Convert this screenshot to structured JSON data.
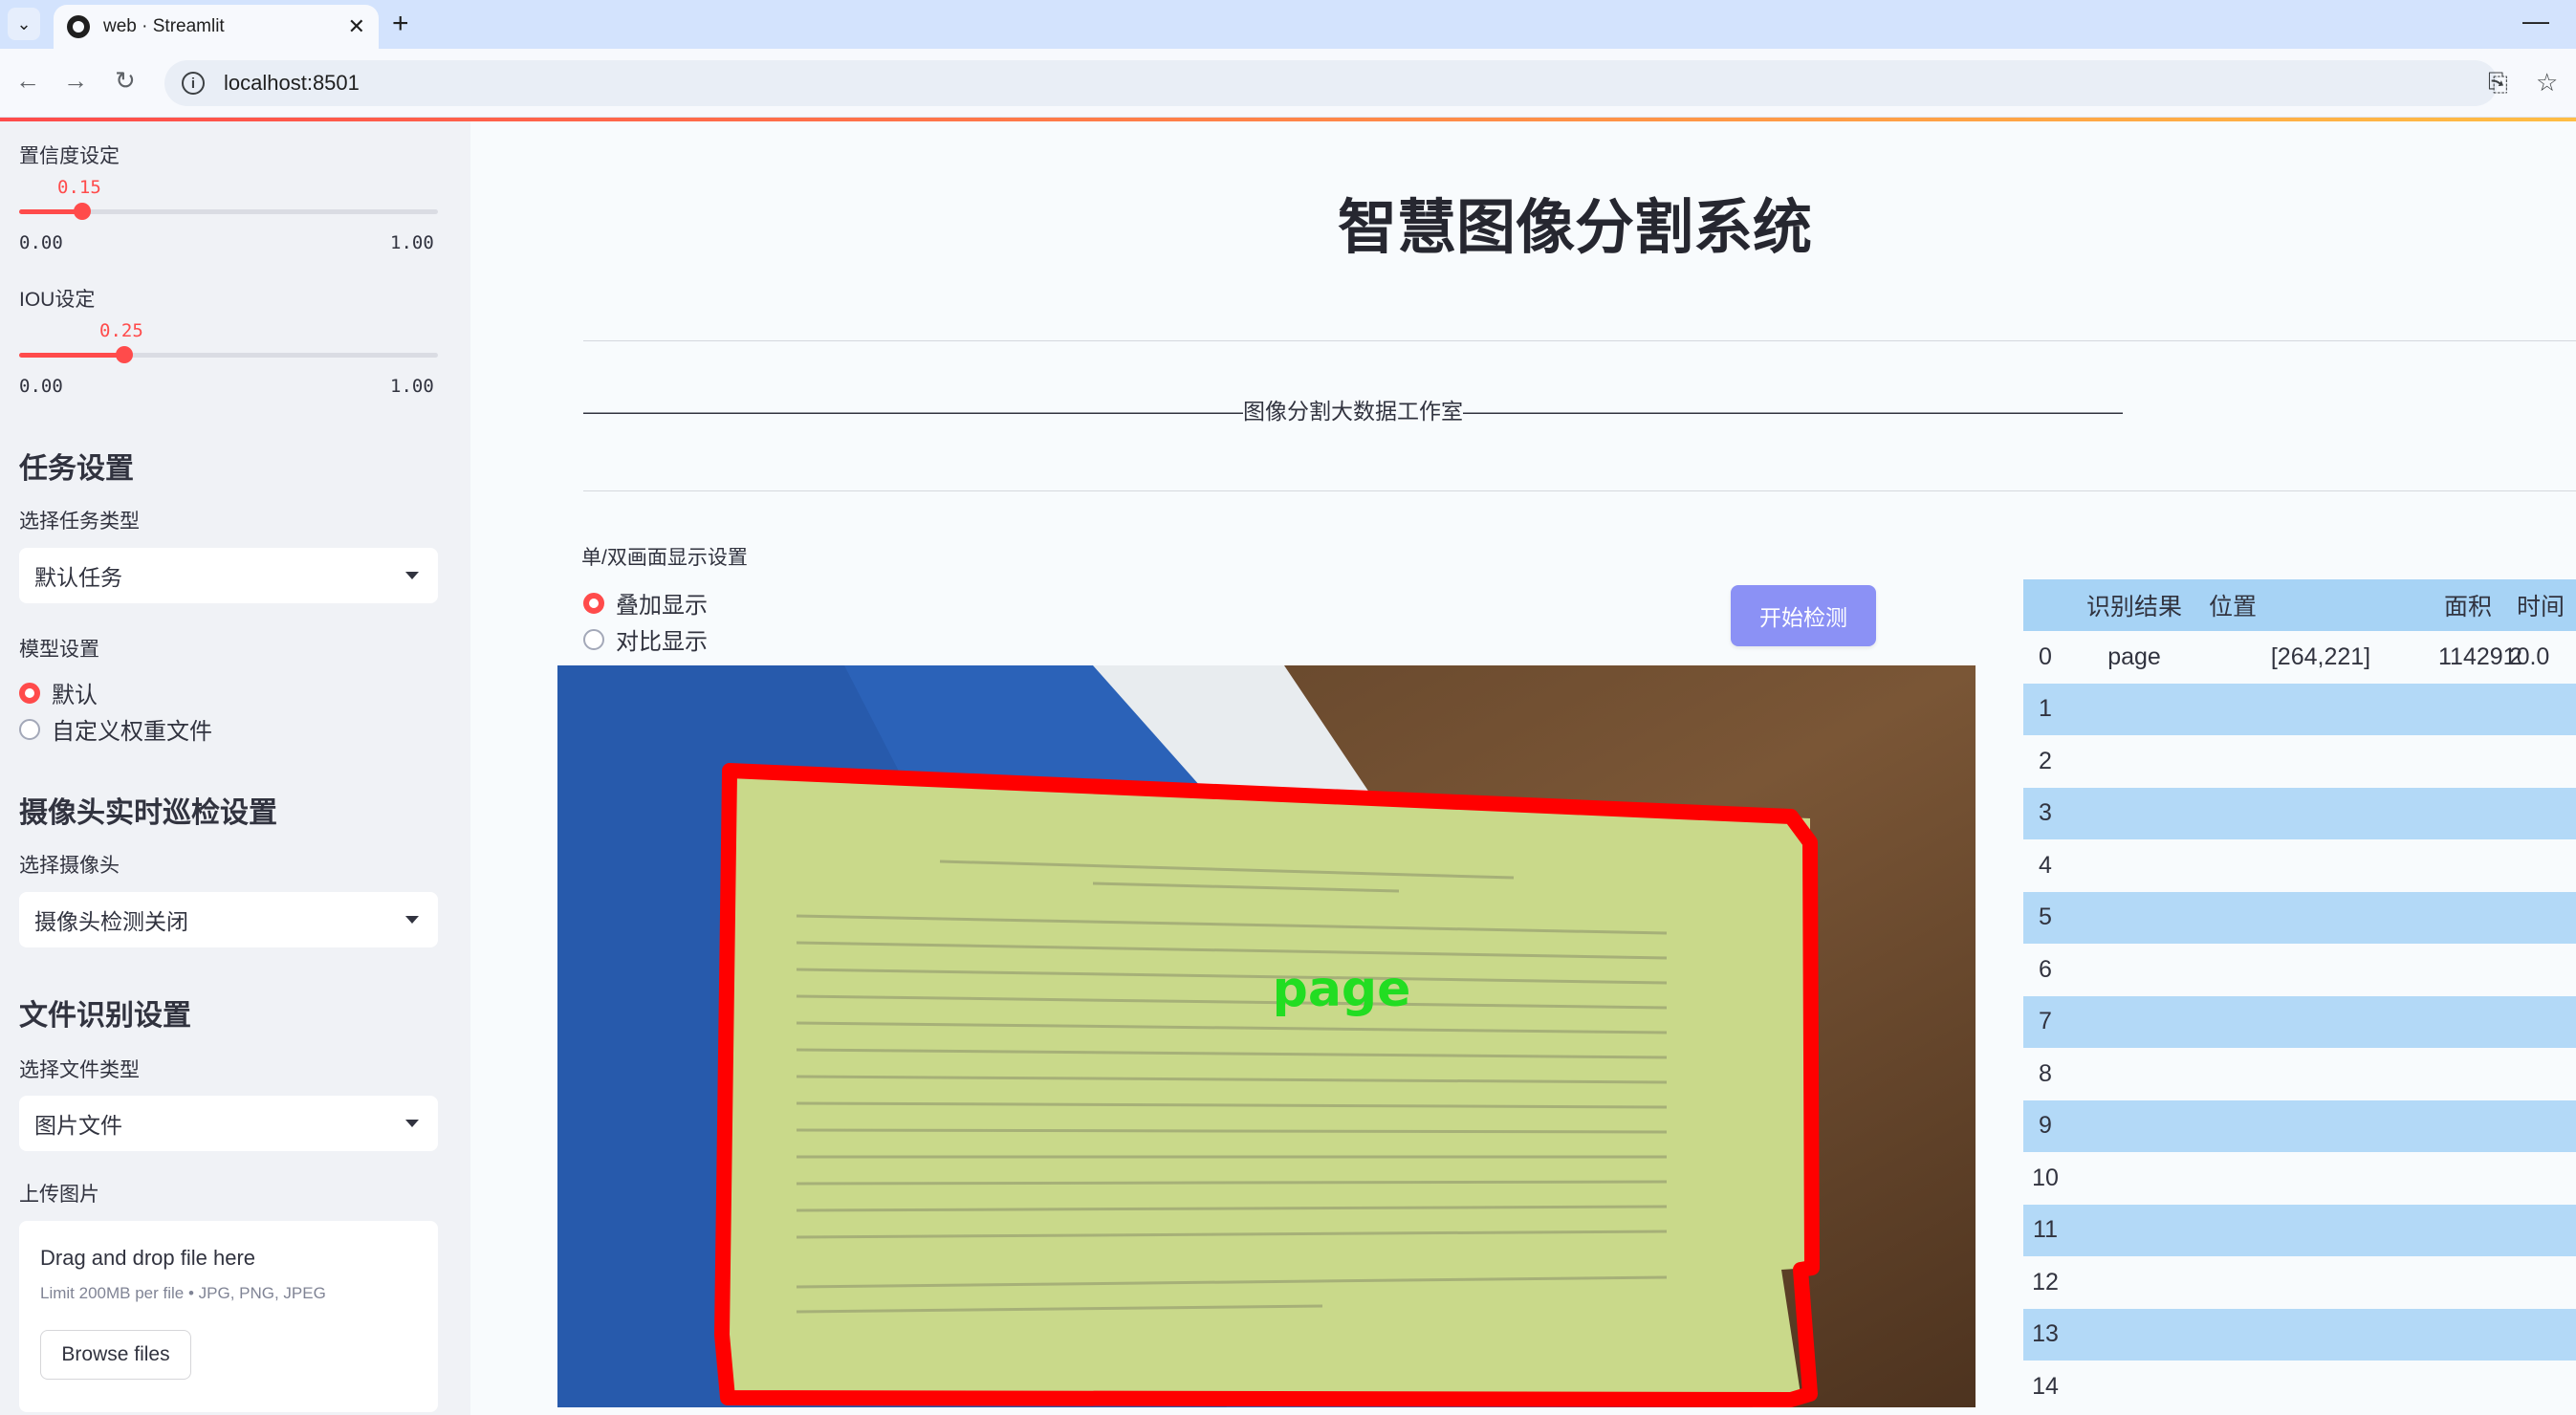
{
  "browser": {
    "tab_title": "web · Streamlit",
    "url": "localhost:8501"
  },
  "sidebar": {
    "confidence": {
      "label": "置信度设定",
      "value_text": "0.15",
      "value": 0.15,
      "min_text": "0.00",
      "max_text": "1.00"
    },
    "iou": {
      "label": "IOU设定",
      "value_text": "0.25",
      "value": 0.25,
      "min_text": "0.00",
      "max_text": "1.00"
    },
    "task_section": {
      "header": "任务设置",
      "select_label": "选择任务类型",
      "selected": "默认任务"
    },
    "model_section": {
      "label": "模型设置",
      "options": [
        "默认",
        "自定义权重文件"
      ],
      "selected_index": 0
    },
    "camera_section": {
      "header": "摄像头实时巡检设置",
      "select_label": "选择摄像头",
      "selected": "摄像头检测关闭"
    },
    "file_section": {
      "header": "文件识别设置",
      "select_label": "选择文件类型",
      "selected": "图片文件"
    },
    "upload": {
      "label": "上传图片",
      "drop_text": "Drag and drop file here",
      "limit_text": "Limit 200MB per file • JPG, PNG, JPEG",
      "button": "Browse files"
    }
  },
  "main": {
    "title": "智慧图像分割系统",
    "studio_line": "——————————————————————————————图像分割大数据工作室——————————————————————————————",
    "display_mode": {
      "label": "单/双画面显示设置",
      "options": [
        "叠加显示",
        "对比显示"
      ],
      "selected_index": 0
    },
    "start_button": "开始检测",
    "detection_label": "page",
    "table": {
      "columns": [
        "识别结果",
        "位置",
        "面积",
        "时间"
      ],
      "rows": [
        {
          "index": "0",
          "result": "page",
          "position": "[264,221]",
          "area": "1142910.0",
          "time": "2"
        },
        {
          "index": "1",
          "result": "",
          "position": "",
          "area": "",
          "time": ""
        },
        {
          "index": "2",
          "result": "",
          "position": "",
          "area": "",
          "time": ""
        },
        {
          "index": "3",
          "result": "",
          "position": "",
          "area": "",
          "time": ""
        },
        {
          "index": "4",
          "result": "",
          "position": "",
          "area": "",
          "time": ""
        },
        {
          "index": "5",
          "result": "",
          "position": "",
          "area": "",
          "time": ""
        },
        {
          "index": "6",
          "result": "",
          "position": "",
          "area": "",
          "time": ""
        },
        {
          "index": "7",
          "result": "",
          "position": "",
          "area": "",
          "time": ""
        },
        {
          "index": "8",
          "result": "",
          "position": "",
          "area": "",
          "time": ""
        },
        {
          "index": "9",
          "result": "",
          "position": "",
          "area": "",
          "time": ""
        },
        {
          "index": "10",
          "result": "",
          "position": "",
          "area": "",
          "time": ""
        },
        {
          "index": "11",
          "result": "",
          "position": "",
          "area": "",
          "time": ""
        },
        {
          "index": "12",
          "result": "",
          "position": "",
          "area": "",
          "time": ""
        },
        {
          "index": "13",
          "result": "",
          "position": "",
          "area": "",
          "time": ""
        },
        {
          "index": "14",
          "result": "",
          "position": "",
          "area": "",
          "time": ""
        }
      ]
    }
  },
  "colors": {
    "accent": "#ff4b4b",
    "button": "#8b91f5",
    "table_stripe": "#b3d9f7",
    "mask": "#c9d98a",
    "outline": "#ff0000",
    "label_text": "#22dd22"
  }
}
